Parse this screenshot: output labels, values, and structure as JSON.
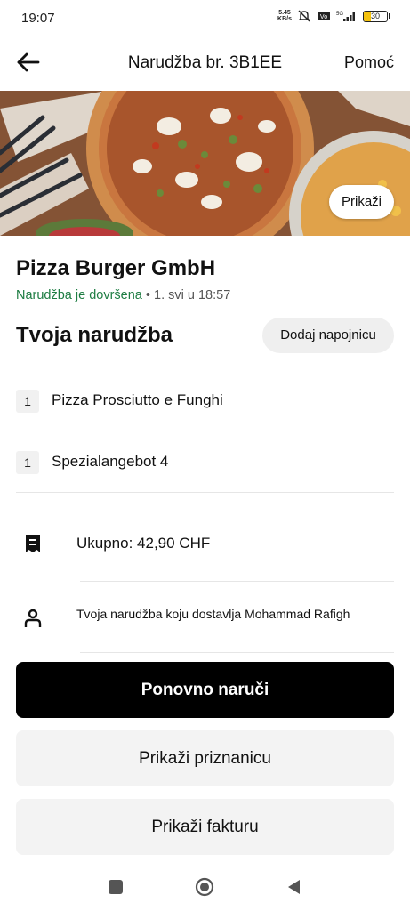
{
  "status_bar": {
    "time": "19:07",
    "net_speed_value": "5.45",
    "net_speed_unit": "KB/s",
    "battery_level": "30",
    "icons": [
      "network-speed",
      "mute-icon",
      "volte-icon",
      "signal-5g-icon",
      "battery-icon"
    ]
  },
  "header": {
    "title": "Narudžba br. 3B1EE",
    "help_label": "Pomoć",
    "back_icon": "arrow-left-icon"
  },
  "hero": {
    "show_label": "Prikaži"
  },
  "store": {
    "name": "Pizza Burger GmbH",
    "status": "Narudžba je dovršena",
    "separator": " • ",
    "date": "1. svi u 18:57"
  },
  "order": {
    "title": "Tvoja narudžba",
    "tip_button": "Dodaj napojnicu",
    "items": [
      {
        "qty": "1",
        "name": "Pizza Prosciutto e Funghi"
      },
      {
        "qty": "1",
        "name": "Spezialangebot 4"
      }
    ],
    "total": "Ukupno: 42,90 CHF",
    "courier": "Tvoja narudžba koju dostavlja Mohammad Rafigh"
  },
  "actions": {
    "reorder": "Ponovno naruči",
    "receipt": "Prikaži priznanicu",
    "invoice": "Prikaži fakturu"
  },
  "colors": {
    "status_green": "#1e7d43",
    "primary_button": "#000000",
    "secondary_button": "#f3f3f3",
    "battery_fill": "#f4c20d"
  }
}
